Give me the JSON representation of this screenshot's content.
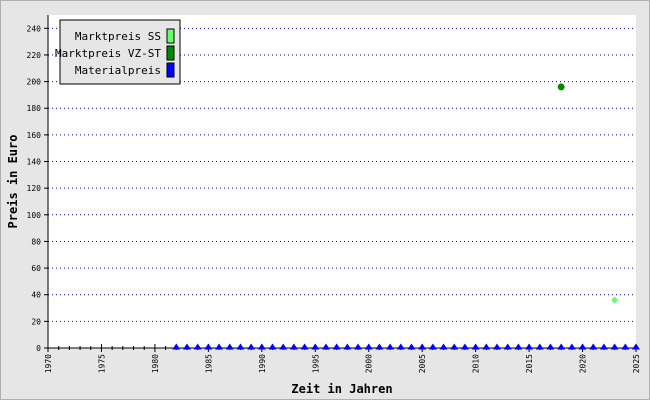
{
  "chart_data": {
    "type": "scatter",
    "title": "",
    "xlabel": "Zeit in Jahren",
    "ylabel": "Preis in Euro",
    "xlim": [
      1970,
      2025
    ],
    "ylim": [
      0,
      250
    ],
    "x_ticks": [
      1970,
      1975,
      1980,
      1985,
      1990,
      1995,
      2000,
      2005,
      2010,
      2015,
      2020,
      2025
    ],
    "y_ticks": [
      0,
      20,
      40,
      60,
      80,
      100,
      120,
      140,
      160,
      180,
      200,
      220,
      240
    ],
    "grid": "horizontal dotted",
    "legend_position": "top-left",
    "series": [
      {
        "name": "Marktpreis SS",
        "color": "#66ff66",
        "marker": "diamond",
        "x": [
          2023
        ],
        "y": [
          36
        ]
      },
      {
        "name": "Marktpreis VZ-ST",
        "color": "#008800",
        "marker": "circle",
        "x": [
          2018
        ],
        "y": [
          196
        ]
      },
      {
        "name": "Materialpreis",
        "color": "#0000ff",
        "marker": "triangle",
        "x": [
          1982,
          1983,
          1984,
          1985,
          1986,
          1987,
          1988,
          1989,
          1990,
          1991,
          1992,
          1993,
          1994,
          1995,
          1996,
          1997,
          1998,
          1999,
          2000,
          2001,
          2002,
          2003,
          2004,
          2005,
          2006,
          2007,
          2008,
          2009,
          2010,
          2011,
          2012,
          2013,
          2014,
          2015,
          2016,
          2017,
          2018,
          2019,
          2020,
          2021,
          2022,
          2023,
          2024,
          2025
        ],
        "y": [
          0,
          0,
          0,
          0,
          0,
          0,
          0,
          0,
          0,
          0,
          0,
          0,
          0,
          0,
          0,
          0,
          0,
          0,
          0,
          0,
          0,
          0,
          0,
          0,
          0,
          0,
          0,
          0,
          0,
          0,
          0,
          0,
          0,
          0,
          0,
          0,
          0,
          0,
          0,
          0,
          0,
          0,
          0,
          0
        ]
      }
    ]
  }
}
